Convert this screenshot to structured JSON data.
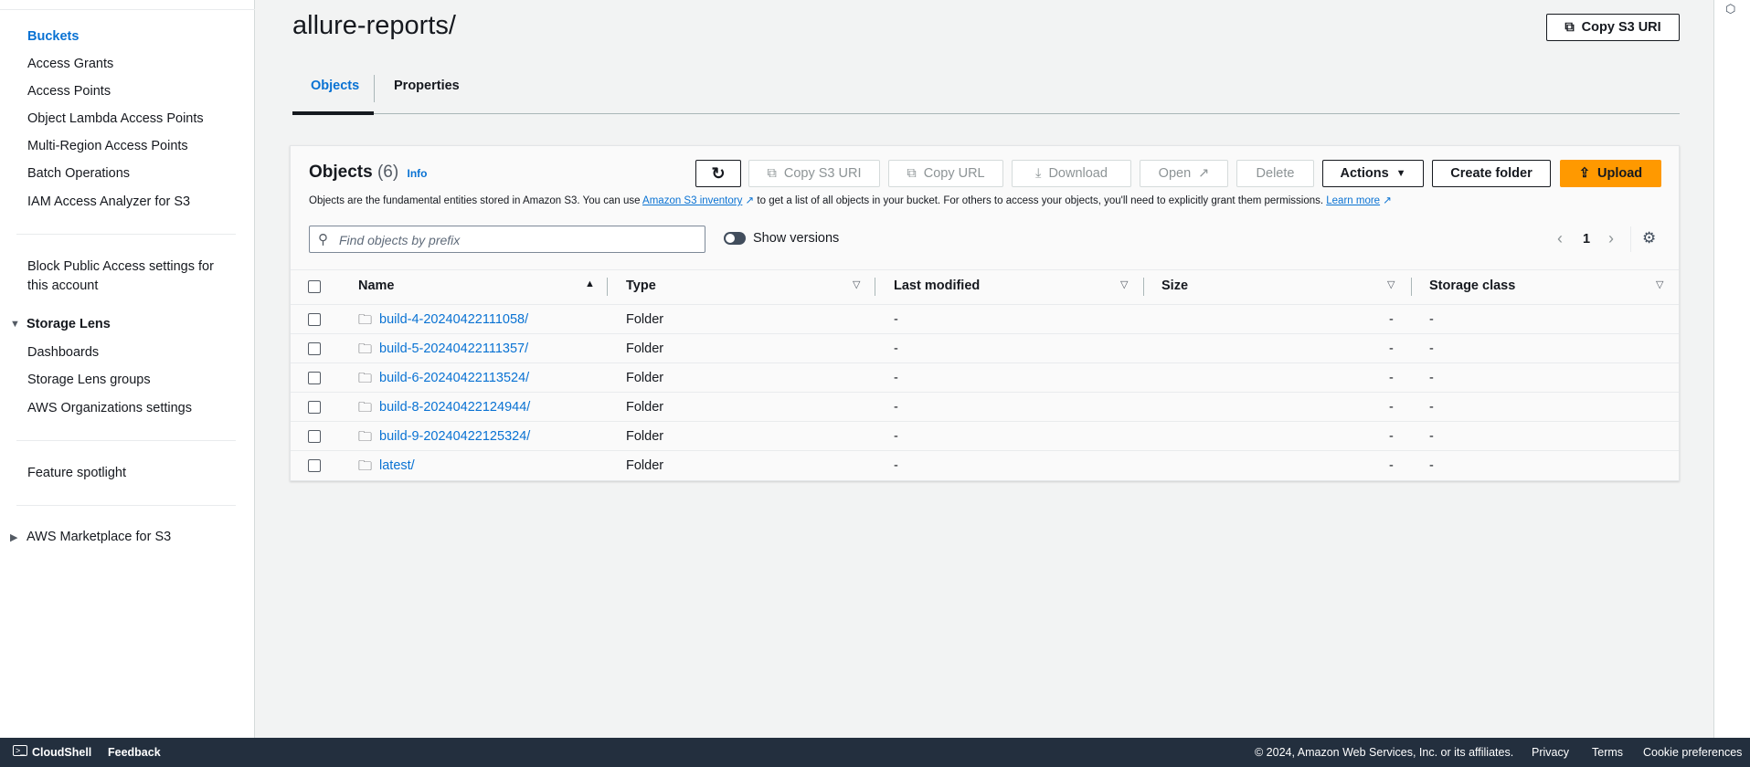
{
  "sidebar": {
    "items": [
      "Buckets",
      "Access Grants",
      "Access Points",
      "Object Lambda Access Points",
      "Multi-Region Access Points",
      "Batch Operations",
      "IAM Access Analyzer for S3"
    ],
    "block_public_1": "Block Public Access settings for",
    "block_public_2": "this account",
    "storage_lens": "Storage Lens",
    "storage_lens_items": [
      "Dashboards",
      "Storage Lens groups",
      "AWS Organizations settings"
    ],
    "feature_spotlight": "Feature spotlight",
    "marketplace": "AWS Marketplace for S3"
  },
  "header": {
    "title": "allure-reports/",
    "copy_s3_uri": "Copy S3 URI"
  },
  "tabs": [
    "Objects",
    "Properties"
  ],
  "objects": {
    "title": "Objects",
    "count": "(6)",
    "info": "Info",
    "desc_1": "Objects are the fundamental entities stored in Amazon S3. You can use",
    "desc_link1": "Amazon S3 inventory",
    "desc_2": "to get a list of all objects in your bucket. For others to access your objects, you'll need to explicitly grant them permissions.",
    "desc_link2": "Learn more",
    "buttons": {
      "copy_s3_uri": "Copy S3 URI",
      "copy_url": "Copy URL",
      "download": "Download",
      "open": "Open",
      "delete": "Delete",
      "actions": "Actions",
      "create_folder": "Create folder",
      "upload": "Upload"
    },
    "search_placeholder": "Find objects by prefix",
    "show_versions": "Show versions",
    "page": "1",
    "columns": [
      "Name",
      "Type",
      "Last modified",
      "Size",
      "Storage class"
    ],
    "rows": [
      {
        "name": "build-4-20240422111058/",
        "type": "Folder",
        "modified": "-",
        "size": "-",
        "storage": "-"
      },
      {
        "name": "build-5-20240422111357/",
        "type": "Folder",
        "modified": "-",
        "size": "-",
        "storage": "-"
      },
      {
        "name": "build-6-20240422113524/",
        "type": "Folder",
        "modified": "-",
        "size": "-",
        "storage": "-"
      },
      {
        "name": "build-8-20240422124944/",
        "type": "Folder",
        "modified": "-",
        "size": "-",
        "storage": "-"
      },
      {
        "name": "build-9-20240422125324/",
        "type": "Folder",
        "modified": "-",
        "size": "-",
        "storage": "-"
      },
      {
        "name": "latest/",
        "type": "Folder",
        "modified": "-",
        "size": "-",
        "storage": "-"
      }
    ]
  },
  "footer": {
    "cloudshell": "CloudShell",
    "feedback": "Feedback",
    "copyright": "© 2024, Amazon Web Services, Inc. or its affiliates.",
    "privacy": "Privacy",
    "terms": "Terms",
    "cookies": "Cookie preferences"
  },
  "colors": {
    "accent": "#0972d3",
    "upload": "#ff9900",
    "footer": "#232f3e"
  }
}
